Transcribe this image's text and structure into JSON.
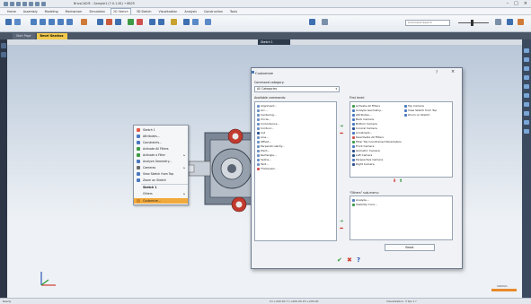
{
  "app": {
    "title": "BricsCAD® - Sample1 (7.0.1-61) • 6625",
    "window_controls": [
      "–",
      "□",
      "×"
    ]
  },
  "ribbon_tabs": [
    {
      "label": "Home",
      "active": false
    },
    {
      "label": "Assembly",
      "active": false
    },
    {
      "label": "Modeling",
      "active": false
    },
    {
      "label": "Mechanism",
      "active": false
    },
    {
      "label": "Simulation",
      "active": false
    },
    {
      "label": "2D Sketch",
      "active": true
    },
    {
      "label": "3D Sketch",
      "active": false
    },
    {
      "label": "Visualization",
      "active": false
    },
    {
      "label": "Analysis",
      "active": false
    },
    {
      "label": "Construction",
      "active": false
    },
    {
      "label": "Tools",
      "active": false
    }
  ],
  "search": {
    "placeholder": "Command Search"
  },
  "doc_tabs": [
    {
      "label": "Start Page",
      "active": false
    },
    {
      "label": "Bevel Gearbox",
      "active": true
    }
  ],
  "sketch_tab": "Sketch 1",
  "context_menu": {
    "items": [
      {
        "label": "Sketch 1",
        "bold": false,
        "sub": false,
        "color": "#e05a4a"
      },
      {
        "label": "Attributes...",
        "bold": false,
        "sub": false,
        "color": "#4a78c0"
      },
      {
        "label": "Constraints...",
        "bold": false,
        "sub": false,
        "color": "#4a78c0"
      },
      {
        "label": "Activate All Filters",
        "bold": false,
        "sub": false,
        "color": "#3f9a48"
      },
      {
        "label": "Activate a Filter",
        "bold": false,
        "sub": true,
        "color": "#3f9a48"
      },
      {
        "label": "Analyze Geometry...",
        "bold": false,
        "sub": false,
        "color": "#4a78c0"
      },
      {
        "label": "Cameras",
        "bold": false,
        "sub": true,
        "color": "#6b6b6b"
      },
      {
        "label": "View Sketch from Top",
        "bold": false,
        "sub": false,
        "color": "#4a78c0"
      },
      {
        "label": "Zoom on Sketch",
        "bold": false,
        "sub": false,
        "color": "#4a78c0"
      },
      {
        "label": "Sketch 1",
        "bold": true,
        "sub": false,
        "color": ""
      },
      {
        "label": "Others",
        "bold": false,
        "sub": true,
        "color": ""
      },
      {
        "label": "Customize...",
        "bold": false,
        "sub": false,
        "color": "#d08a2a"
      }
    ]
  },
  "dialog": {
    "title": "Customize",
    "help_glyph": "?",
    "close_glyph": "×",
    "category_label": "Command category:",
    "category_value": "All Categories",
    "available_label": "Available commands:",
    "available": [
      {
        "label": "Alignment...",
        "color": "#6a8fc4"
      },
      {
        "label": "Arc...",
        "color": "#6a8fc4"
      },
      {
        "label": "Centering...",
        "color": "#6a8fc4"
      },
      {
        "label": "Circle...",
        "color": "#6a8fc4"
      },
      {
        "label": "Coincidence...",
        "color": "#6a8fc4"
      },
      {
        "label": "Contour...",
        "color": "#6a8fc4"
      },
      {
        "label": "Cut",
        "color": "#2e4f8f"
      },
      {
        "label": "Line...",
        "color": "#6a8fc4"
      },
      {
        "label": "Offset...",
        "color": "#6a8fc4"
      },
      {
        "label": "Perpendicularity...",
        "color": "#6a8fc4"
      },
      {
        "label": "Point...",
        "color": "#6a8fc4"
      },
      {
        "label": "Rectangle...",
        "color": "#6a8fc4"
      },
      {
        "label": "Spline...",
        "color": "#6a8fc4"
      },
      {
        "label": "Text...",
        "color": "#6a8fc4"
      },
      {
        "label": "Thickened...",
        "color": "#d05050"
      }
    ],
    "first_label": "First level:",
    "first_col1": [
      {
        "label": "Activate All Filters",
        "color": "#3f9a48"
      },
      {
        "label": "Analyze Geometry...",
        "color": "#4a78c0"
      },
      {
        "label": "Attributes...",
        "color": "#4a78c0"
      },
      {
        "label": "Back Camera",
        "color": "#4a78c0"
      },
      {
        "label": "Bottom Camera",
        "color": "#4a78c0"
      },
      {
        "label": "Conical Camera",
        "color": "#2e4f8f"
      },
      {
        "label": "Constraint...",
        "color": "#4a78c0"
      },
      {
        "label": "Deactivate All Filters",
        "color": "#d05050"
      },
      {
        "label": "Filter Top Constrained Parameters",
        "color": "#3f9a48"
      },
      {
        "label": "Front Camera",
        "color": "#4a78c0"
      },
      {
        "label": "Isometric Camera",
        "color": "#2e4f8f"
      },
      {
        "label": "Left Camera",
        "color": "#2e4f8f"
      },
      {
        "label": "Perspective Camera",
        "color": "#4a78c0"
      },
      {
        "label": "Right Camera",
        "color": "#2e4f8f"
      }
    ],
    "first_col2": [
      {
        "label": "Top Camera",
        "color": "#4a78c0"
      },
      {
        "label": "View Sketch from Top",
        "color": "#4a78c0"
      },
      {
        "label": "Zoom on Sketch",
        "color": "#4a78c0"
      }
    ],
    "other_label": "\"Others\" sub-menu:",
    "others": [
      {
        "label": "Analyze...",
        "color": "#4a78c0"
      },
      {
        "label": "Visibility Cons...",
        "color": "#3f9a48"
      }
    ],
    "reset_label": "Reset",
    "ok_glyph": "✔",
    "cancel_glyph": "✖",
    "help_button_glyph": "?"
  },
  "status": {
    "left": "Ready",
    "coords": "X=+200.00   Y=+200.00   Z=+200.00",
    "right": "Visualization: 3 fps 1 ?"
  },
  "scale_label": "100mm",
  "colors": {
    "accent": "#f2a93b",
    "ok": "#2e9b3a",
    "cancel": "#d13a2f",
    "help": "#2b58b8"
  }
}
